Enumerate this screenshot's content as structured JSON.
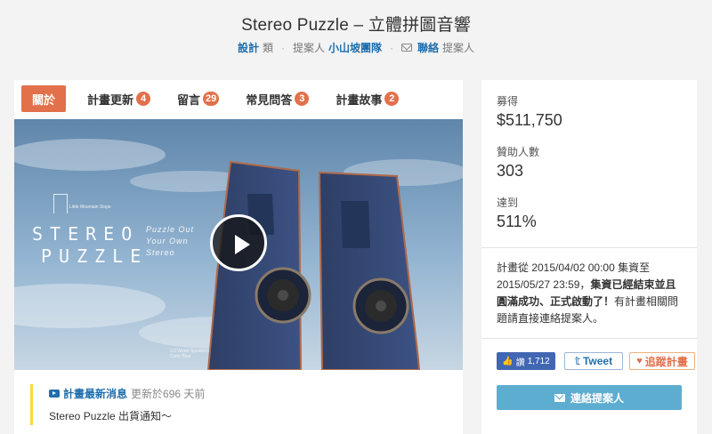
{
  "project": {
    "title": "Stereo Puzzle – 立體拼圖音響",
    "category": "設計",
    "category_suffix": "類",
    "proposer_prefix": "提案人",
    "proposer": "小山坡團隊",
    "contact_link": "聯絡",
    "contact_suffix": "提案人"
  },
  "tabs": [
    {
      "label": "關於",
      "active": true
    },
    {
      "label": "計畫更新",
      "count": "4"
    },
    {
      "label": "留言",
      "count": "29"
    },
    {
      "label": "常見問答",
      "count": "3"
    },
    {
      "label": "計畫故事",
      "count": "2"
    }
  ],
  "video": {
    "brand_small": "Little Mountain Slope",
    "brand_line1": "STEREO",
    "brand_line2": "PUZZLE",
    "tagline1": "Puzzle Out",
    "tagline2": "Your Own",
    "tagline3": "Stereo",
    "caption1": "2.0 Wood Speakers",
    "caption2": "Color Blue"
  },
  "news": {
    "label": "計畫最新消息",
    "updated": "更新於696 天前",
    "text": "Stereo Puzzle 出貨通知～"
  },
  "sidebar": {
    "raised_label": "募得",
    "raised_value": "$511,750",
    "backers_label": "贊助人數",
    "backers_value": "303",
    "percent_label": "達到",
    "percent_value": "511%",
    "desc1": "計畫從 2015/04/02 00:00 集資至 2015/05/27 23:59，",
    "desc_bold": "集資已經結束並且圓滿成功、正式啟動了！",
    "desc2": "有計畫相關問題請直接連絡提案人。",
    "fb_label": "讚",
    "fb_count": "1,712",
    "tweet_label": "Tweet",
    "follow_label": "追蹤計畫",
    "contact_label": "連絡提案人"
  },
  "colors": {
    "accent": "#e2704b",
    "link": "#1f6fae",
    "contact": "#5dadd0",
    "facebook": "#4267b2",
    "news_border": "#ffd83b"
  }
}
